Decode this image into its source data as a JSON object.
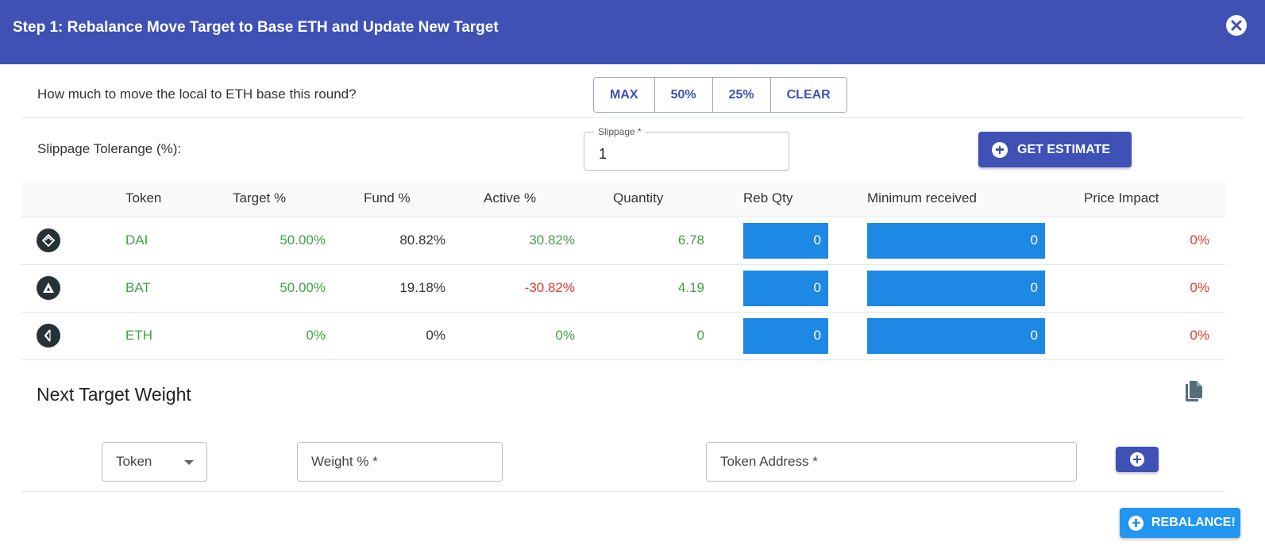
{
  "dialog": {
    "title": "Step 1: Rebalance Move Target to Base ETH and Update New Target",
    "close_icon": "close-icon"
  },
  "move": {
    "question": "How much to move the local to ETH base this round?",
    "buttons": [
      "MAX",
      "50%",
      "25%",
      "CLEAR"
    ]
  },
  "slippage": {
    "label": "Slippage Tolerange (%):",
    "field_label": "Slippage *",
    "value": "1",
    "estimate_button": "GET ESTIMATE"
  },
  "table": {
    "headers": [
      "Token",
      "Target %",
      "Fund %",
      "Active %",
      "Quantity",
      "Reb Qty",
      "Minimum received",
      "Price Impact"
    ],
    "rows": [
      {
        "icon": "dai-token-icon",
        "token": "DAI",
        "target": "50.00%",
        "fund": "80.82%",
        "active": "30.82%",
        "active_color": "green",
        "quantity": "6.78",
        "reb_qty": "0",
        "min_received": "0",
        "price_impact": "0%"
      },
      {
        "icon": "bat-token-icon",
        "token": "BAT",
        "target": "50.00%",
        "fund": "19.18%",
        "active": "-30.82%",
        "active_color": "red",
        "quantity": "4.19",
        "reb_qty": "0",
        "min_received": "0",
        "price_impact": "0%"
      },
      {
        "icon": "eth-token-icon",
        "token": "ETH",
        "target": "0%",
        "fund": "0%",
        "active": "0%",
        "active_color": "green",
        "quantity": "0",
        "reb_qty": "0",
        "min_received": "0",
        "price_impact": "0%"
      }
    ]
  },
  "next_target": {
    "title": "Next Target Weight",
    "copy_icon": "copy-icon",
    "token_select": "Token",
    "weight_field": "Weight % *",
    "address_field": "Token Address *"
  },
  "rebalance_button": "REBALANCE!",
  "colors": {
    "header": "#3f51b5",
    "primary": "#3f51b5",
    "accent_blue": "#2196f3",
    "cell_blue": "#1e88e5",
    "positive": "#43a047",
    "negative": "#e53935"
  }
}
